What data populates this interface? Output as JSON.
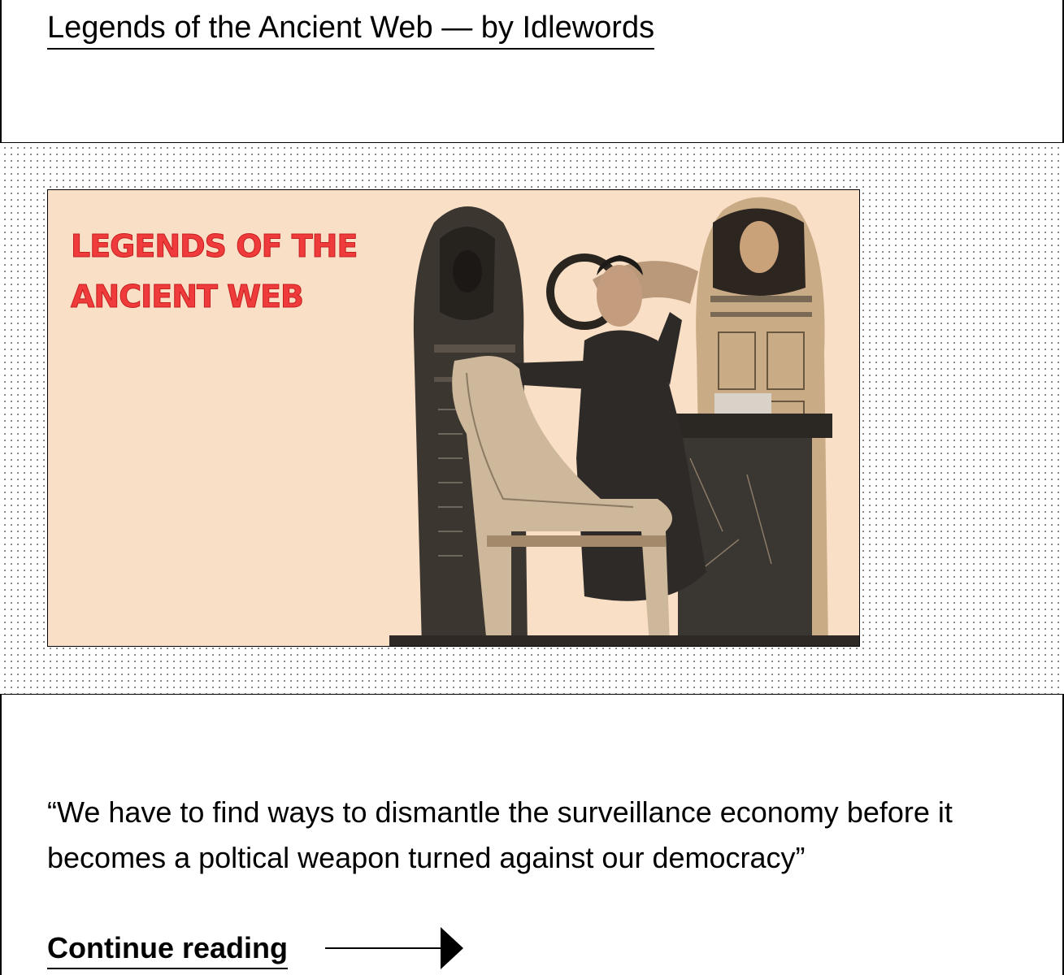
{
  "post": {
    "title": "Legends of the Ancient Web — by Idlewords",
    "image": {
      "title_text": "LEGENDS OF THE\nANCIENT WEB",
      "background_color": "#f9dfc6",
      "title_color": "#ef3b3b"
    },
    "excerpt": "“We have to find ways to dismantle the surveillance economy before it becomes a poltical weapon turned against our democracy”",
    "continue_label": "Continue reading",
    "continue_icon": "arrow-right-icon"
  }
}
